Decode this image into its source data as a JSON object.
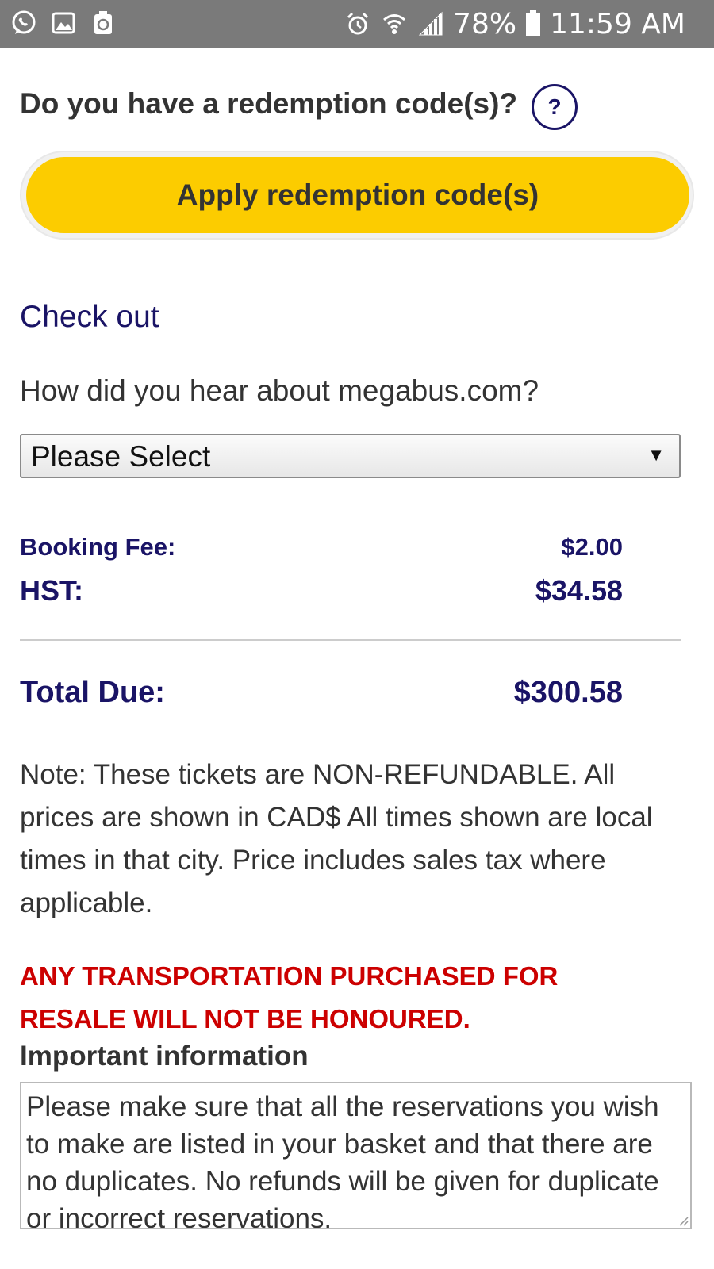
{
  "status_bar": {
    "left_icons": [
      "whatsapp-icon",
      "gallery-icon",
      "recycle-icon"
    ],
    "right_icons": [
      "alarm-icon",
      "wifi-icon",
      "signal-icon",
      "battery-icon"
    ],
    "battery_percent": "78%",
    "time": "11:59 AM"
  },
  "redemption": {
    "question": "Do you have a redemption code(s)?",
    "help_label": "?",
    "apply_label": "Apply redemption code(s)"
  },
  "checkout": {
    "heading": "Check out",
    "hear_label": "How did you hear about megabus.com?",
    "hear_select_value": "Please Select"
  },
  "fees": {
    "booking_fee_label": "Booking Fee:",
    "booking_fee_value": "$2.00",
    "hst_label": "HST:",
    "hst_value": "$34.58",
    "total_label": "Total Due:",
    "total_value": "$300.58"
  },
  "note": "Note: These tickets are NON-REFUNDABLE. All prices are shown in CAD$ All times shown are local times in that city. Price includes sales tax where applicable.",
  "warning": "ANY TRANSPORTATION PURCHASED FOR RESALE WILL NOT BE HONOURED.",
  "important": {
    "heading": "Important information",
    "text": "Please make sure that all the reservations you wish to make are listed in your basket and that there are no duplicates. No refunds will be given for duplicate or incorrect reservations."
  },
  "colors": {
    "status_bar": "#7a7a7a",
    "accent_button": "#fccc00",
    "navy": "#1a1466",
    "warning": "#cc0000"
  }
}
